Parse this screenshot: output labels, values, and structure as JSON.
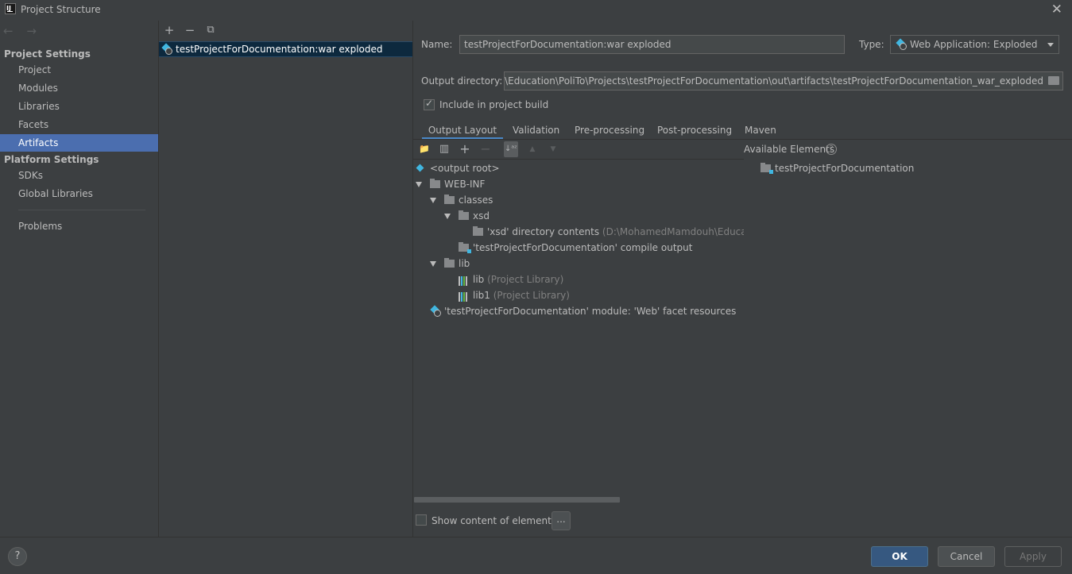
{
  "window": {
    "title": "Project Structure",
    "close_glyph": "✕"
  },
  "nav": {
    "back_forward": "← →",
    "sections": [
      {
        "title": "Project Settings",
        "items": [
          "Project",
          "Modules",
          "Libraries",
          "Facets",
          "Artifacts"
        ]
      },
      {
        "title": "Platform Settings",
        "items": [
          "SDKs",
          "Global Libraries"
        ]
      }
    ],
    "extra_item": "Problems",
    "selected": "Artifacts"
  },
  "artifacts_panel": {
    "toolbar": {
      "add": "+",
      "remove": "−",
      "copy": "⧉"
    },
    "items": [
      "testProjectForDocumentation:war exploded"
    ]
  },
  "details": {
    "name_label": "Name:",
    "name_value": "testProjectForDocumentation:war exploded",
    "type_label": "Type:",
    "type_value": "Web Application: Exploded",
    "output_dir_label": "Output directory:",
    "output_dir_value": "Mamdouh\\Education\\PoliTo\\Projects\\testProjectForDocumentation\\out\\artifacts\\testProjectForDocumentation_war_exploded",
    "include_build_label": "Include in project build",
    "include_build_checked": true,
    "tabs": [
      "Output Layout",
      "Validation",
      "Pre-processing",
      "Post-processing",
      "Maven"
    ],
    "active_tab": "Output Layout"
  },
  "layout_toolbar": {
    "new_dir": "📁",
    "archive": "▥",
    "add": "+",
    "remove": "−",
    "sort": "↓ᵃᶻ",
    "up": "▲",
    "down": "▼"
  },
  "tree": {
    "root": "<output root>",
    "web_inf": "WEB-INF",
    "classes": "classes",
    "xsd": "xsd",
    "xsd_contents": "'xsd' directory contents",
    "xsd_contents_path": "(D:\\MohamedMamdouh\\Education\\I",
    "compile_output": "'testProjectForDocumentation' compile output",
    "lib": "lib",
    "lib_entries": [
      {
        "name": "lib",
        "kind": "(Project Library)"
      },
      {
        "name": "lib1",
        "kind": "(Project Library)"
      }
    ],
    "facet_resources": "'testProjectForDocumentation' module: 'Web' facet resources"
  },
  "available": {
    "title": "Available Elements",
    "help": "?",
    "items": [
      "testProjectForDocumentation"
    ]
  },
  "show_content": {
    "label": "Show content of elements",
    "checked": false,
    "button": "..."
  },
  "footer": {
    "help": "?",
    "ok": "OK",
    "cancel": "Cancel",
    "apply": "Apply"
  },
  "colors": {
    "background": "#3c3f41",
    "selection": "#4b6eaf",
    "list_selection": "#0d293e",
    "accent": "#40b6e0",
    "ok_button": "#365880"
  }
}
